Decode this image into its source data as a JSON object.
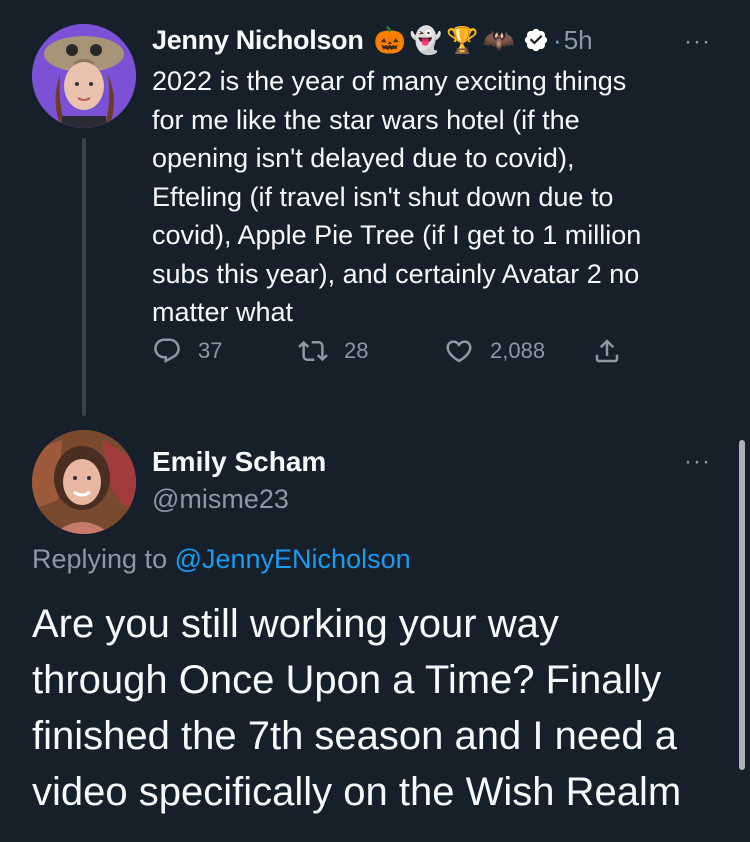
{
  "tweet1": {
    "author_name": "Jenny Nicholson",
    "emojis": [
      "🎃",
      "👻",
      "🏆",
      "🦇"
    ],
    "separator": "·",
    "time": "5h",
    "more": "···",
    "text": "2022 is the year of many exciting things\nfor me like the star wars hotel (if the\nopening isn't delayed due to covid),\nEfteling (if travel isn't shut down due to\ncovid), Apple Pie Tree (if I get to 1 million\nsubs this year), and certainly Avatar 2 no\nmatter what",
    "reply_count": "37",
    "retweet_count": "28",
    "like_count": "2,088"
  },
  "tweet2": {
    "author_name": "Emily Scham",
    "handle": "@misme23",
    "more": "···",
    "replying_prefix": "Replying to ",
    "replying_to": "@JennyENicholson",
    "text": "Are you still working your way\nthrough Once Upon a Time? Finally\nfinished the 7th season and I need a\nvideo specifically on the Wish Realm"
  },
  "colors": {
    "background": "#15202b",
    "text": "#f7f9f9",
    "secondary": "#8b98a5",
    "link": "#1d9bf0",
    "verified": "#ffffff"
  },
  "icons": [
    "reply-icon",
    "retweet-icon",
    "like-icon",
    "share-icon",
    "verified-badge-icon"
  ]
}
